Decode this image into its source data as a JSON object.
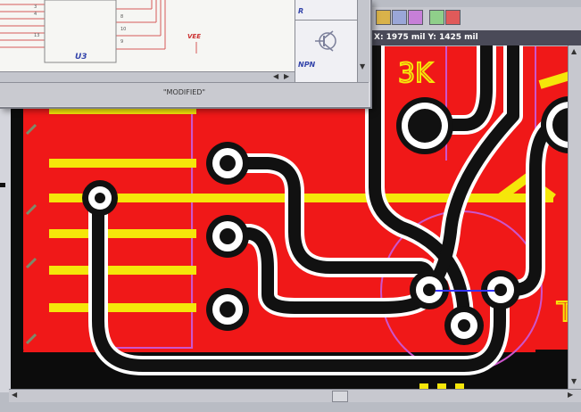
{
  "schematic": {
    "part_label": "U3",
    "net_label": "VEE",
    "status_text": "\"MODIFIED\""
  },
  "palette": {
    "item_top_label": "R",
    "item_bottom_label": "NPN"
  },
  "pcb": {
    "coordinates": "X: 1975 mil  Y: 1425 mil",
    "silkscreen_top": "3K",
    "silkscreen_right": "T",
    "colors": {
      "copper": "#f01818",
      "trace": "#111111",
      "silkscreen": "#f5e60a",
      "outline": "#cc55cc",
      "pad": "#ffffff"
    }
  },
  "toolbar": {
    "icons": [
      "layer-icon",
      "grid-icon",
      "route-icon",
      "view-icon",
      "color-icon"
    ]
  }
}
